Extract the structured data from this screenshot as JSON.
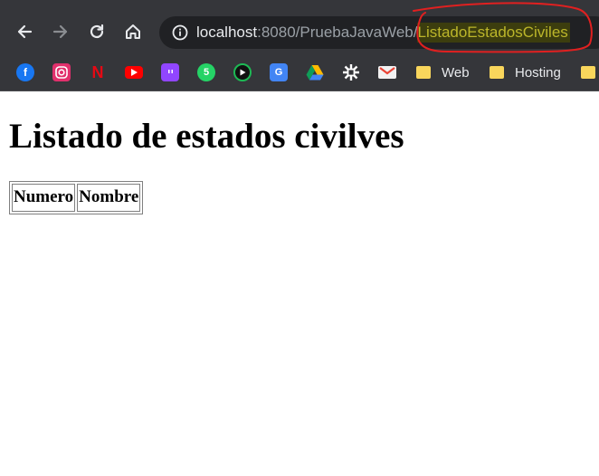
{
  "browser": {
    "url_host": "localhost",
    "url_port_path": ":8080/PruebaJavaWeb/",
    "url_highlighted": "ListadoEstadosCiviles",
    "bookmarks": [
      {
        "icon": "facebook-icon",
        "label": "",
        "color": "#1877f2"
      },
      {
        "icon": "instagram-icon",
        "label": "",
        "color": "#e1306c"
      },
      {
        "icon": "netflix-icon",
        "label": "",
        "color": "#e50914"
      },
      {
        "icon": "youtube-icon",
        "label": "",
        "color": "#ff0000"
      },
      {
        "icon": "twitch-icon",
        "label": "",
        "color": "#9146ff"
      },
      {
        "icon": "whatsapp-icon",
        "label": "",
        "color": "#25d366"
      },
      {
        "icon": "play-circle-icon",
        "label": "",
        "color": "#1db954"
      },
      {
        "icon": "google-translate-icon",
        "label": "",
        "color": "#4285f4"
      },
      {
        "icon": "google-drive-icon",
        "label": "",
        "color": "#0f9d58"
      },
      {
        "icon": "utn-logo-icon",
        "label": "",
        "color": "#ffffff"
      },
      {
        "icon": "gmail-icon",
        "label": "",
        "color": "#ea4335"
      },
      {
        "icon": "folder-icon",
        "label": "Web",
        "color": "#f9d65c"
      },
      {
        "icon": "folder-icon",
        "label": "Hosting",
        "color": "#f9d65c"
      }
    ]
  },
  "page": {
    "title": "Listado de estados civilves",
    "table_headers": [
      "Numero",
      "Nombre"
    ]
  },
  "colors": {
    "toolbar": "#35363a",
    "omnibox": "#202124",
    "annotation": "#e02020",
    "url_highlight": "#bcb62a"
  }
}
